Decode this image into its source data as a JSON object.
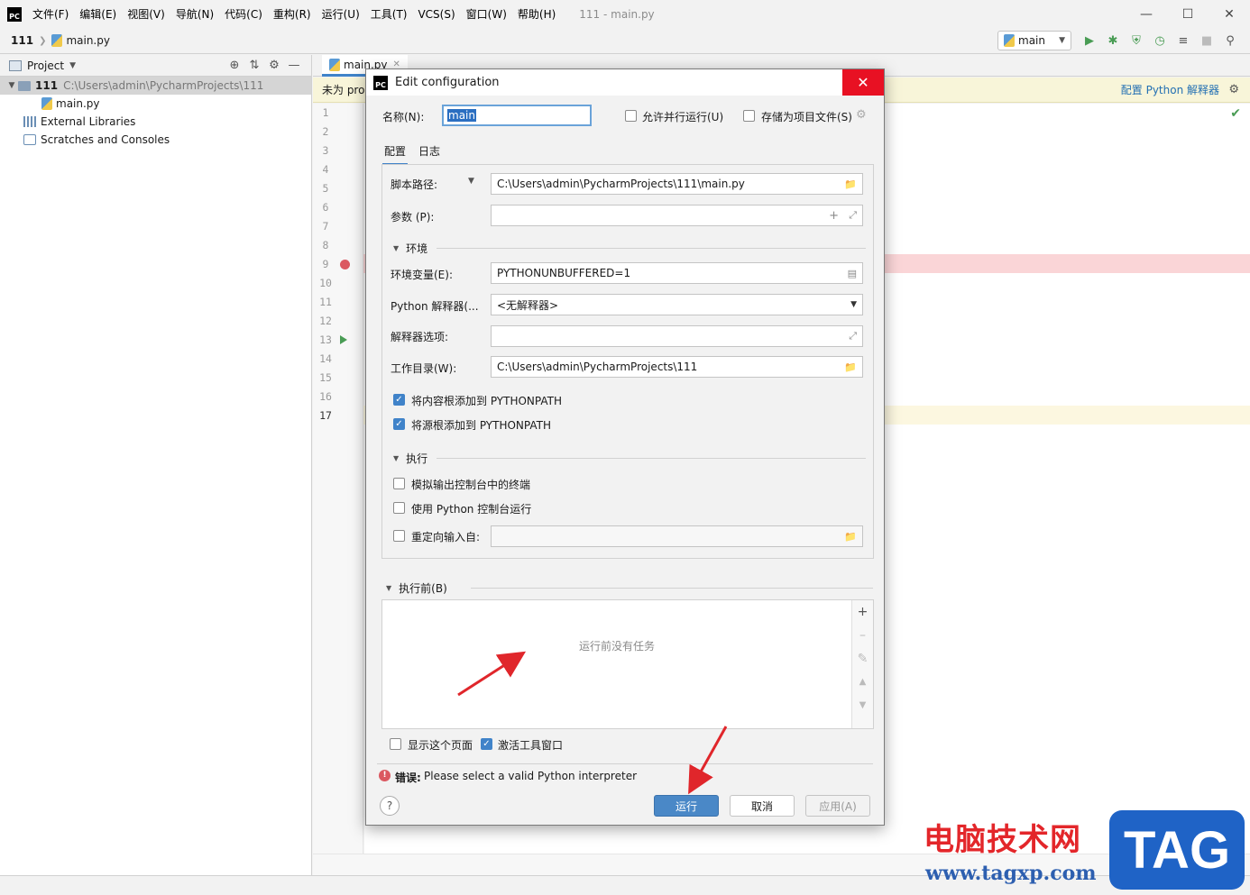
{
  "menubar": {
    "logo": "PC",
    "items": [
      "文件(F)",
      "编辑(E)",
      "视图(V)",
      "导航(N)",
      "代码(C)",
      "重构(R)",
      "运行(U)",
      "工具(T)",
      "VCS(S)",
      "窗口(W)",
      "帮助(H)"
    ],
    "title": "111 - main.py"
  },
  "navbar": {
    "root": "111",
    "file": "main.py",
    "run_config": "main"
  },
  "project_panel": {
    "header": "Project",
    "root_name": "111",
    "root_path": "C:\\Users\\admin\\PycharmProjects\\111",
    "file": "main.py",
    "external_libraries": "External Libraries",
    "scratches": "Scratches and Consoles"
  },
  "editor": {
    "tab": "main.py",
    "banner_text": "未为 pro",
    "banner_link": "配置 Python 解释器",
    "line_numbers": [
      "1",
      "2",
      "3",
      "4",
      "5",
      "6",
      "7",
      "8",
      "9",
      "10",
      "11",
      "12",
      "13",
      "14",
      "15",
      "16",
      "17"
    ],
    "breakpoint_line": 9,
    "run_line": 13,
    "current_line": 17
  },
  "dialog": {
    "title": "Edit configuration",
    "name_label": "名称(N):",
    "name_value": "main",
    "allow_parallel": "允许并行运行(U)",
    "store_as_file": "存储为项目文件(S)",
    "tabs": [
      "配置",
      "日志"
    ],
    "script_label": "脚本路径:",
    "script_value": "C:\\Users\\admin\\PycharmProjects\\111\\main.py",
    "params_label": "参数 (P):",
    "params_value": "",
    "env_section": "环境",
    "env_vars_label": "环境变量(E):",
    "env_vars_value": "PYTHONUNBUFFERED=1",
    "interpreter_label": "Python 解释器(...",
    "interpreter_value": "<无解释器>",
    "interp_options_label": "解释器选项:",
    "workdir_label": "工作目录(W):",
    "workdir_value": "C:\\Users\\admin\\PycharmProjects\\111",
    "add_content_roots": "将内容根添加到 PYTHONPATH",
    "add_source_roots": "将源根添加到 PYTHONPATH",
    "exec_section": "执行",
    "emulate_terminal": "模拟输出控制台中的终端",
    "run_with_console": "使用 Python 控制台运行",
    "redirect_input": "重定向输入自:",
    "before_launch_section": "执行前(B)",
    "no_tasks": "运行前没有任务",
    "show_page": "显示这个页面",
    "activate_tool_window": "激活工具窗口",
    "error_label": "错误:",
    "error_message": "Please select a valid Python interpreter",
    "run_button": "运行",
    "cancel_button": "取消",
    "apply_button": "应用(A)"
  },
  "watermark": {
    "text": "电脑技术网",
    "url": "www.tagxp.com",
    "tag": "TAG"
  }
}
